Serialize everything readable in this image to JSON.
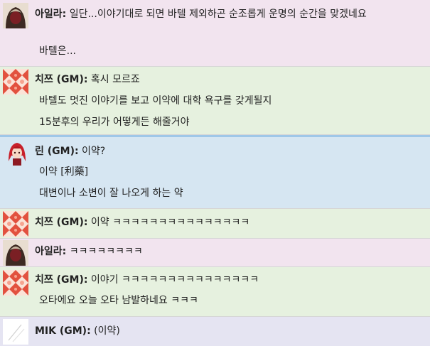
{
  "messages": [
    {
      "speaker": "아일라:",
      "avatar": "hooded-figure-avatar",
      "lines": [
        "일단...이야기대로 되면 바텔 제외하곤 순조롭게 운명의 순간을 맞겠네요",
        "바텔은..."
      ]
    },
    {
      "speaker": "치쯔 (GM):",
      "avatar": "red-pattern-avatar",
      "lines": [
        "혹시 모르죠",
        "바텔도 멋진 이야기를 보고 이약에 대학 욕구를 갖게될지",
        "15분후의 우리가 어떻게든 해줄거야"
      ]
    },
    {
      "speaker": "린 (GM):",
      "avatar": "red-haired-girl-avatar",
      "lines": [
        "이약?",
        "이약 [利藥]",
        "대변이나 소변이 잘 나오게 하는 약"
      ]
    },
    {
      "speaker": "치쯔 (GM):",
      "avatar": "red-pattern-avatar",
      "lines": [
        "이약 ㅋㅋㅋㅋㅋㅋㅋㅋㅋㅋㅋㅋㅋㅋㅋ"
      ]
    },
    {
      "speaker": "아일라:",
      "avatar": "hooded-figure-avatar",
      "lines": [
        "ㅋㅋㅋㅋㅋㅋㅋㅋ"
      ]
    },
    {
      "speaker": "치쯔 (GM):",
      "avatar": "red-pattern-avatar",
      "lines": [
        "이야기 ㅋㅋㅋㅋㅋㅋㅋㅋㅋㅋㅋㅋㅋㅋㅋ",
        "오타에요 오늘 오타 남발하네요 ㅋㅋㅋ"
      ]
    },
    {
      "speaker": "MIK (GM):",
      "avatar": "sketch-avatar",
      "lines": [
        "(이약)"
      ]
    }
  ]
}
